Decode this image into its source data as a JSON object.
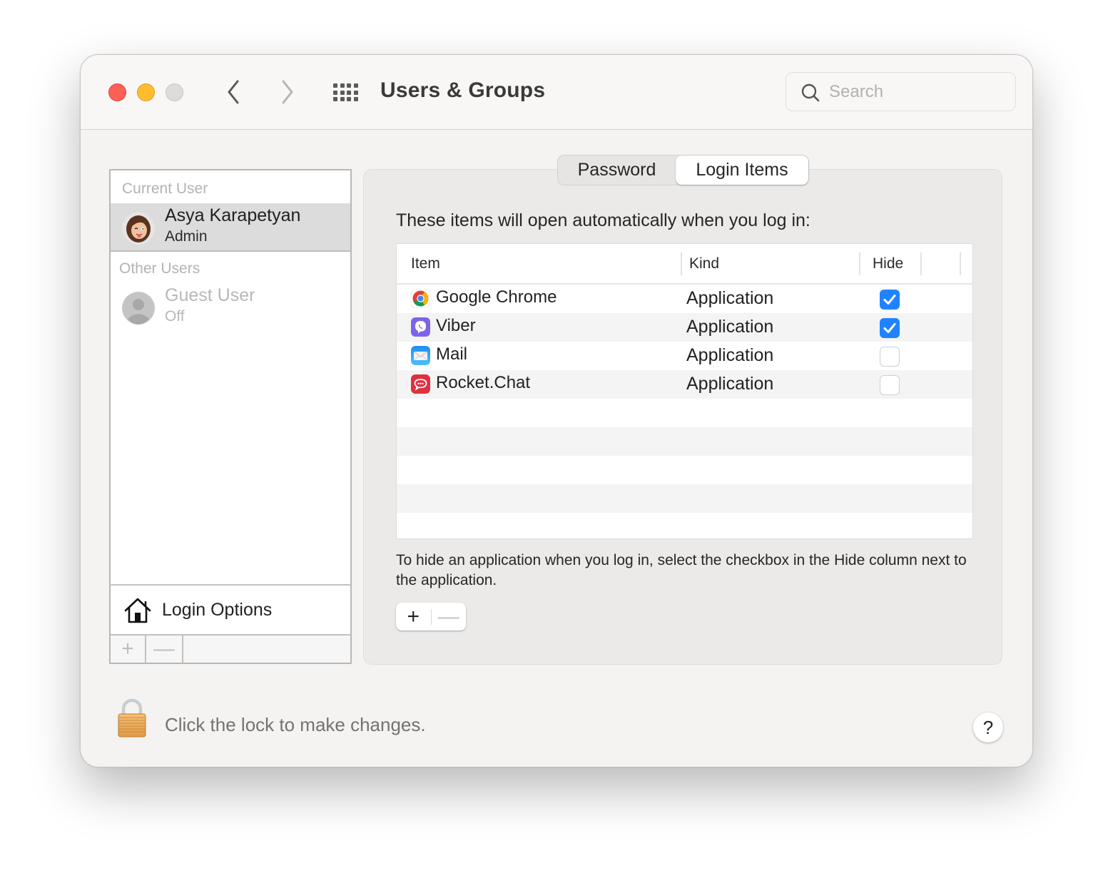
{
  "window": {
    "title": "Users & Groups",
    "traffic_lights": {
      "close": "#fe5f57",
      "minimize": "#febc2e",
      "zoom": "#dddcdb"
    }
  },
  "toolbar": {
    "back_icon": "chevron-left-icon",
    "forward_icon": "chevron-right-icon",
    "show_all_icon": "grid-icon",
    "search": {
      "placeholder": "Search",
      "value": ""
    }
  },
  "sidebar": {
    "current_user_label": "Current User",
    "current_user": {
      "name": "Asya Karapetyan",
      "role": "Admin",
      "selected": true
    },
    "other_users_label": "Other Users",
    "other_users": [
      {
        "name": "Guest User",
        "status": "Off",
        "enabled": false
      }
    ],
    "login_options_label": "Login Options",
    "add_label": "+",
    "remove_label": "—"
  },
  "tabs": [
    {
      "label": "Password",
      "active": false
    },
    {
      "label": "Login Items",
      "active": true
    }
  ],
  "login_items": {
    "intro": "These items will open automatically when you log in:",
    "columns": [
      "Item",
      "Kind",
      "Hide"
    ],
    "rows": [
      {
        "name": "Google Chrome",
        "kind": "Application",
        "hide": true,
        "icon": "chrome-icon"
      },
      {
        "name": "Viber",
        "kind": "Application",
        "hide": true,
        "icon": "viber-icon"
      },
      {
        "name": "Mail",
        "kind": "Application",
        "hide": false,
        "icon": "mail-icon"
      },
      {
        "name": "Rocket.Chat",
        "kind": "Application",
        "hide": false,
        "icon": "rocketchat-icon"
      }
    ],
    "help_text": "To hide an application when you log in, select the checkbox in the Hide column next to the application.",
    "add_label": "+",
    "remove_label": "—"
  },
  "footer": {
    "lock_text": "Click the lock to make changes.",
    "help_label": "?"
  },
  "colors": {
    "accent": "#1f83ff"
  }
}
